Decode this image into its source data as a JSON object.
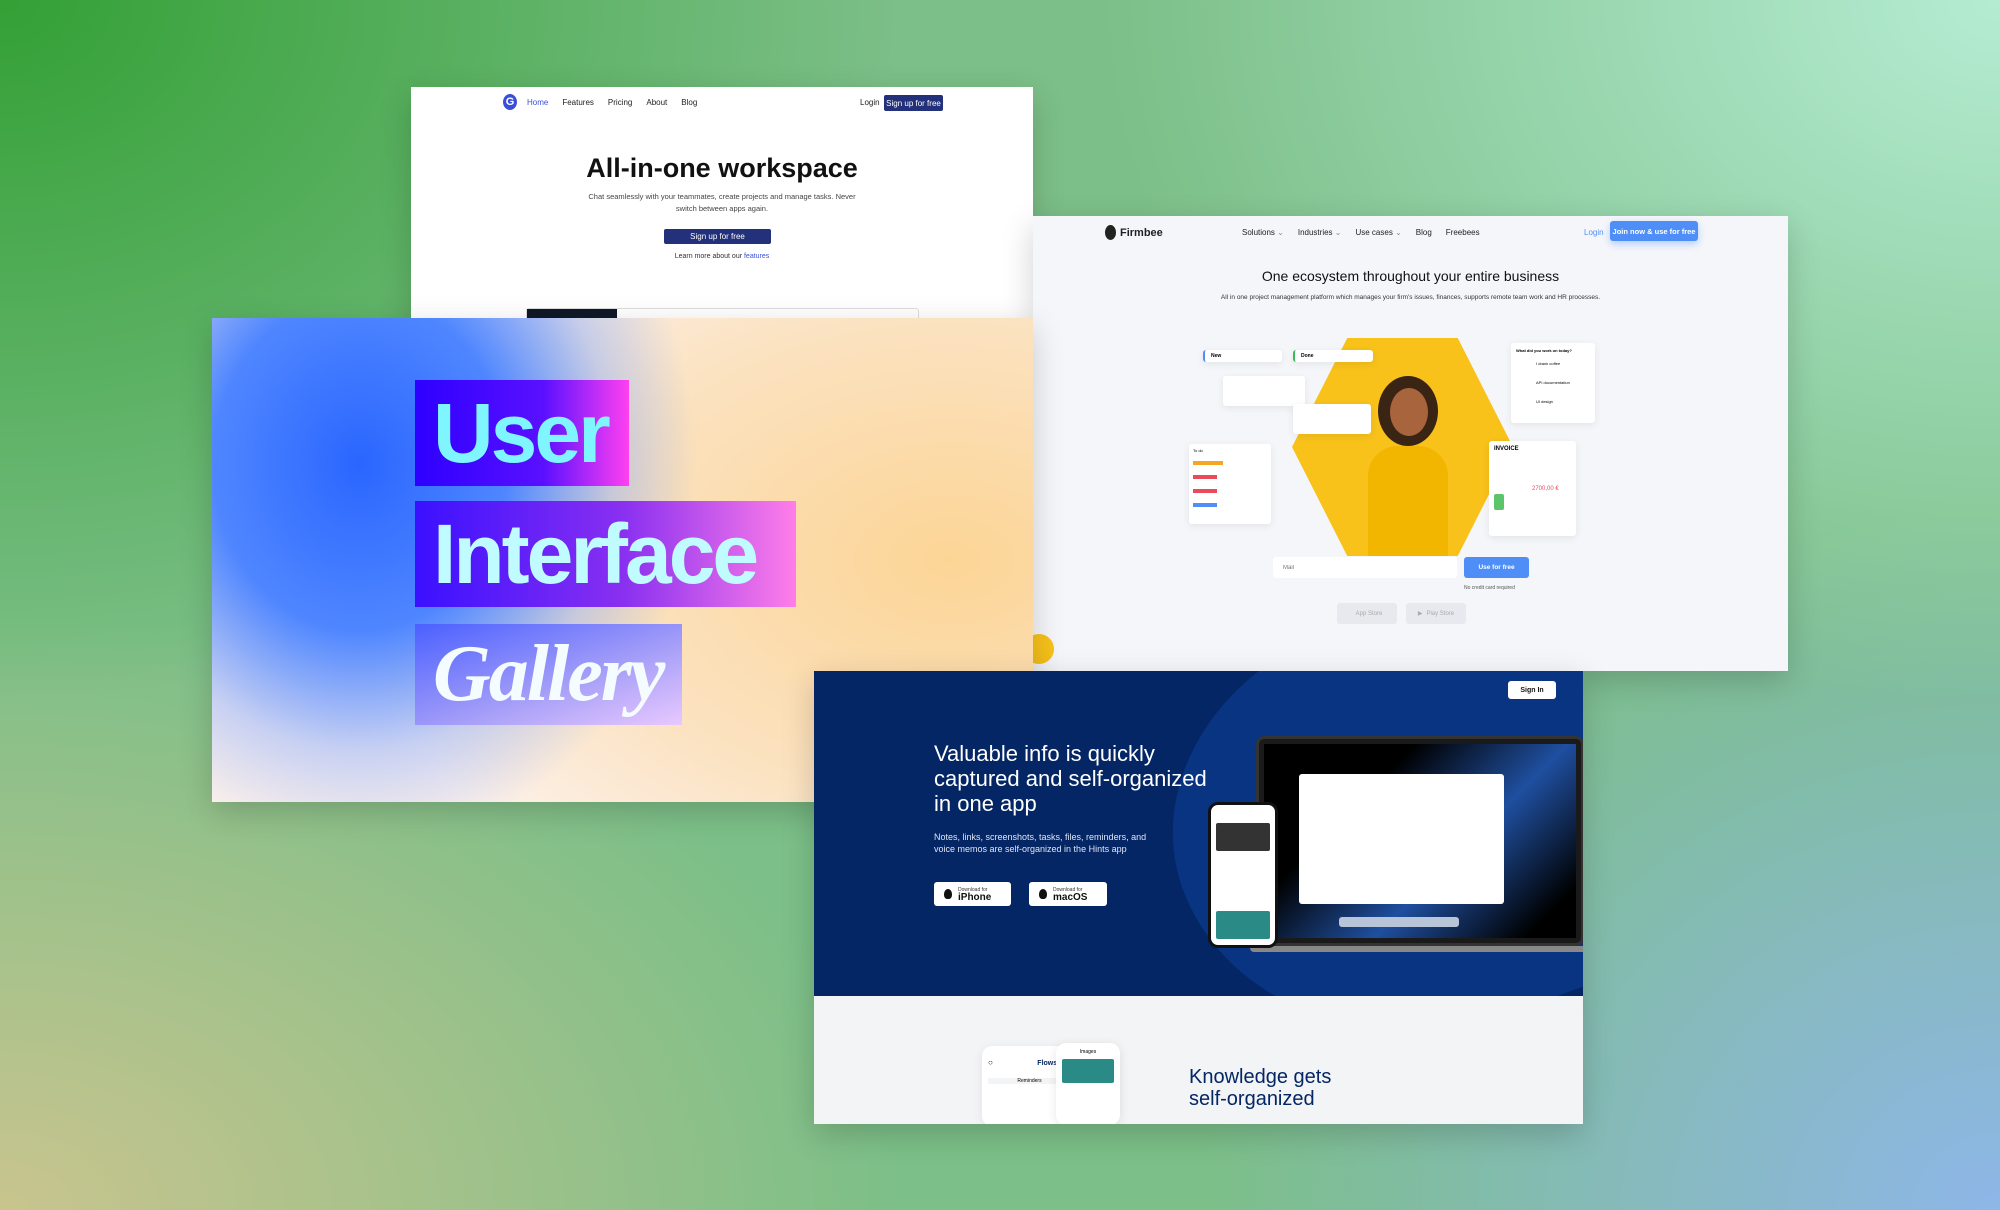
{
  "workspace": {
    "logo": "G",
    "nav": [
      "Home",
      "Features",
      "Pricing",
      "About",
      "Blog"
    ],
    "login": "Login",
    "signup_nav": "Sign up for free",
    "title": "All-in-one workspace",
    "subtitle_line1": "Chat seamlessly with your teammates, create projects and manage tasks. Never",
    "subtitle_line2": "switch between apps again.",
    "cta": "Sign up for free",
    "learn_more": "Learn more about our ",
    "learn_link": "features",
    "accent": "#23307a"
  },
  "gallery": {
    "line1": "User",
    "line2": "Interface",
    "line3": "Gallery"
  },
  "firmbee": {
    "logo": "Firmbee",
    "nav": [
      "Solutions",
      "Industries",
      "Use cases",
      "Blog",
      "Freebees"
    ],
    "login": "Login",
    "join": "Join now & use for free",
    "title": "One ecosystem throughout your entire business",
    "subtitle": "All in one project management platform which manages your firm's issues, finances, supports remote team work and HR processes.",
    "kanban": [
      "New",
      "Done"
    ],
    "todo": "To do",
    "chat_title": "What did you work on today?",
    "chat_items": [
      "I drank coffee",
      "API documentation",
      "UI design"
    ],
    "invoice_title": "INVOICE",
    "invoice_total": "2700,00 €",
    "mail_placeholder": "Mail",
    "use_free": "Use for free",
    "no_card": "No credit card required",
    "app_store": "App Store",
    "play_store": "Play Store",
    "accent": "#4f8ef7",
    "hex_color": "#f8c21b"
  },
  "hints": {
    "sign_in": "Sign In",
    "headline": [
      "Valuable info is quickly",
      "captured and self-organized",
      "in one app"
    ],
    "desc": [
      "Notes, links, screenshots, tasks, files, reminders, and",
      "voice memos are self-organized in the Hints app"
    ],
    "download_for": "Download for",
    "iphone": "iPhone",
    "macos": "macOS",
    "flows": "Flows",
    "images": "Images",
    "reminders": "Reminders",
    "knowledge": [
      "Knowledge gets",
      "self-organized"
    ],
    "bg": "#042665"
  }
}
